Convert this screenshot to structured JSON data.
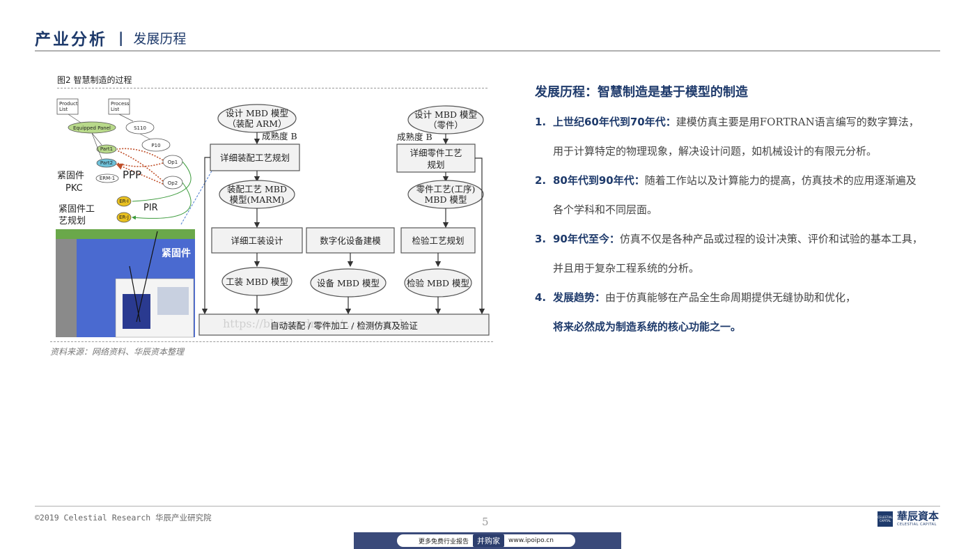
{
  "header": {
    "section": "产业分析",
    "separator": "|",
    "subsection": "发展历程"
  },
  "figure": {
    "caption": "图2 智慧制造的过程",
    "source": "资料来源：网络资料、华辰资本整理",
    "left_panel": {
      "product_list": "Product\nList",
      "process_list": "Process\nList",
      "equipped_panel": "Equipped Panel",
      "s110": "S110",
      "p10": "P10",
      "part1": "Part1",
      "part2": "Part2",
      "op1": "Op1",
      "op2": "Op2",
      "erm1": "ERM-1",
      "er_a": "ER-I",
      "er_b": "ER-J",
      "fastener_pkc_1": "紧固件",
      "fastener_pkc_2": "PKC",
      "ppp": "PPP",
      "pir": "PIR",
      "fastener_plan_1": "紧固件工",
      "fastener_plan_2": "艺规划",
      "fastener_img_label": "紧固件"
    },
    "nodes": {
      "assy_mbd_1": "设计 MBD 模型",
      "assy_mbd_2": "（装配 ARM）",
      "maturity_a": "成熟度 B",
      "part_mbd_1": "设计 MBD 模型",
      "part_mbd_2": "（零件）",
      "maturity_b": "成熟度 B",
      "detail_assy_plan": "详细装配工艺规划",
      "detail_part_plan_1": "详细零件工艺",
      "detail_part_plan_2": "规划",
      "marm_1": "装配工艺 MBD",
      "marm_2": "模型(MARM)",
      "part_proc_1": "零件工艺(工序)",
      "part_proc_2": "MBD 模型",
      "tooling_design": "详细工装设计",
      "digital_equipment": "数字化设备建模",
      "inspection_plan": "检验工艺规划",
      "tooling_mbd": "工装 MBD 模型",
      "equipment_mbd": "设备 MBD 模型",
      "inspection_mbd": "检验 MBD 模型",
      "bottom_bar": "自动装配 / 零件加工 / 检测仿真及验证",
      "watermark": "https://blog.csdn.net/... research"
    }
  },
  "content": {
    "title": "发展历程：智慧制造是基于模型的制造",
    "items": [
      {
        "num": "1.",
        "head": "上世纪60年代到70年代：",
        "body": "建模仿真主要是用FORTRAN语言编写的数字算法，用于计算特定的物理现象，解决设计问题，如机械设计的有限元分析。",
        "emph": ""
      },
      {
        "num": "2.",
        "head": "80年代到90年代：",
        "body": "随着工作站以及计算能力的提高，仿真技术的应用逐渐遍及各个学科和不同层面。",
        "emph": ""
      },
      {
        "num": "3.",
        "head": "90年代至今：",
        "body": "仿真不仅是各种产品或过程的设计决策、评价和试验的基本工具，并且用于复杂工程系统的分析。",
        "emph": ""
      },
      {
        "num": "4.",
        "head": "发展趋势：",
        "body": "由于仿真能够在产品全生命周期提供无缝协助和优化，",
        "emph": "将来必然成为制造系统的核心功能之一。"
      }
    ]
  },
  "footer": {
    "copyright": "©2019 Celestial Research 华辰产业研究院",
    "page": "5",
    "logo_mark": "CELESTIAL CAPITAL",
    "logo_cn": "華辰資本",
    "logo_en": "CELESTIAL CAPITAL",
    "banner_left": "更多免费行业报告",
    "banner_brand": "并购家",
    "banner_url": "www.ipoipo.cn"
  },
  "colors": {
    "brand": "#1e3a6b",
    "rule": "#b0b0b0",
    "banner": "#3a4a7a"
  }
}
